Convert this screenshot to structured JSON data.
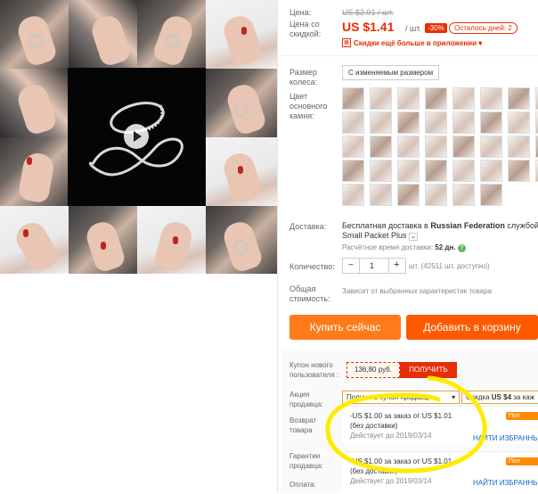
{
  "price": {
    "price_label": "Цена:",
    "original_price": "US $2.01 / шт.",
    "discount_label": "Цена со скидкой:",
    "discount_price": "US $1.41",
    "per_unit": "/ шт.",
    "discount_pct": "-30%",
    "days_left": "Осталось дней: 2",
    "app_promo": "Скидки ещё больше в приложении"
  },
  "options": {
    "size_label": "Размер колеса:",
    "size_value": "С изменяемым размером",
    "color_label": "Цвет основного камня:"
  },
  "shipping": {
    "label": "Доставка:",
    "text_prefix": "Бесплатная доставка в",
    "country": "Russian Federation",
    "text_via": "службой",
    "carrier": "Small Packet Plus",
    "eta_label": "Расчётное время доставки:",
    "eta_value": "52 дн."
  },
  "quantity": {
    "label": "Количество:",
    "value": "1",
    "minus": "−",
    "plus": "+",
    "stock": "шт. (42511 шт. доступно)"
  },
  "total": {
    "label": "Общая стоимость:",
    "value": "Зависит от выбранных характеристик товара"
  },
  "actions": {
    "buy_now": "Купить сейчас",
    "add_to_cart": "Добавить в корзину"
  },
  "coupon": {
    "label": "Купон нового пользователя :",
    "amount": "136,80 руб.",
    "get": "ПОЛУЧИТЬ"
  },
  "promo": {
    "label": "Акция продавца:",
    "get_coupon": "Получить купон продавца",
    "discount_prefix": "Скидка",
    "discount_amount": "US $4",
    "discount_suffix": "за каж"
  },
  "offers": [
    {
      "title": "-US $1.00 за заказ от US $1.01",
      "note": "(без доставки)",
      "valid": "Действует до 2019/03/14",
      "tag": "Пол",
      "link": "НАЙТИ ИЗБРАННЬ"
    },
    {
      "title": "-US $1.00 за заказ от US $1.01",
      "note": "(без доставки)",
      "valid": "Действует до 2019/03/14",
      "tag": "Пол",
      "link": "НАЙТИ ИЗБРАННЬ"
    }
  ],
  "return_label": "Возврат товара",
  "guarantee_label": "Гарантии продавца:",
  "payment_label": "Оплата:",
  "colors": {
    "accent": "#e62e04",
    "orange": "#ff8a00",
    "highlight": "#ffeb00"
  }
}
